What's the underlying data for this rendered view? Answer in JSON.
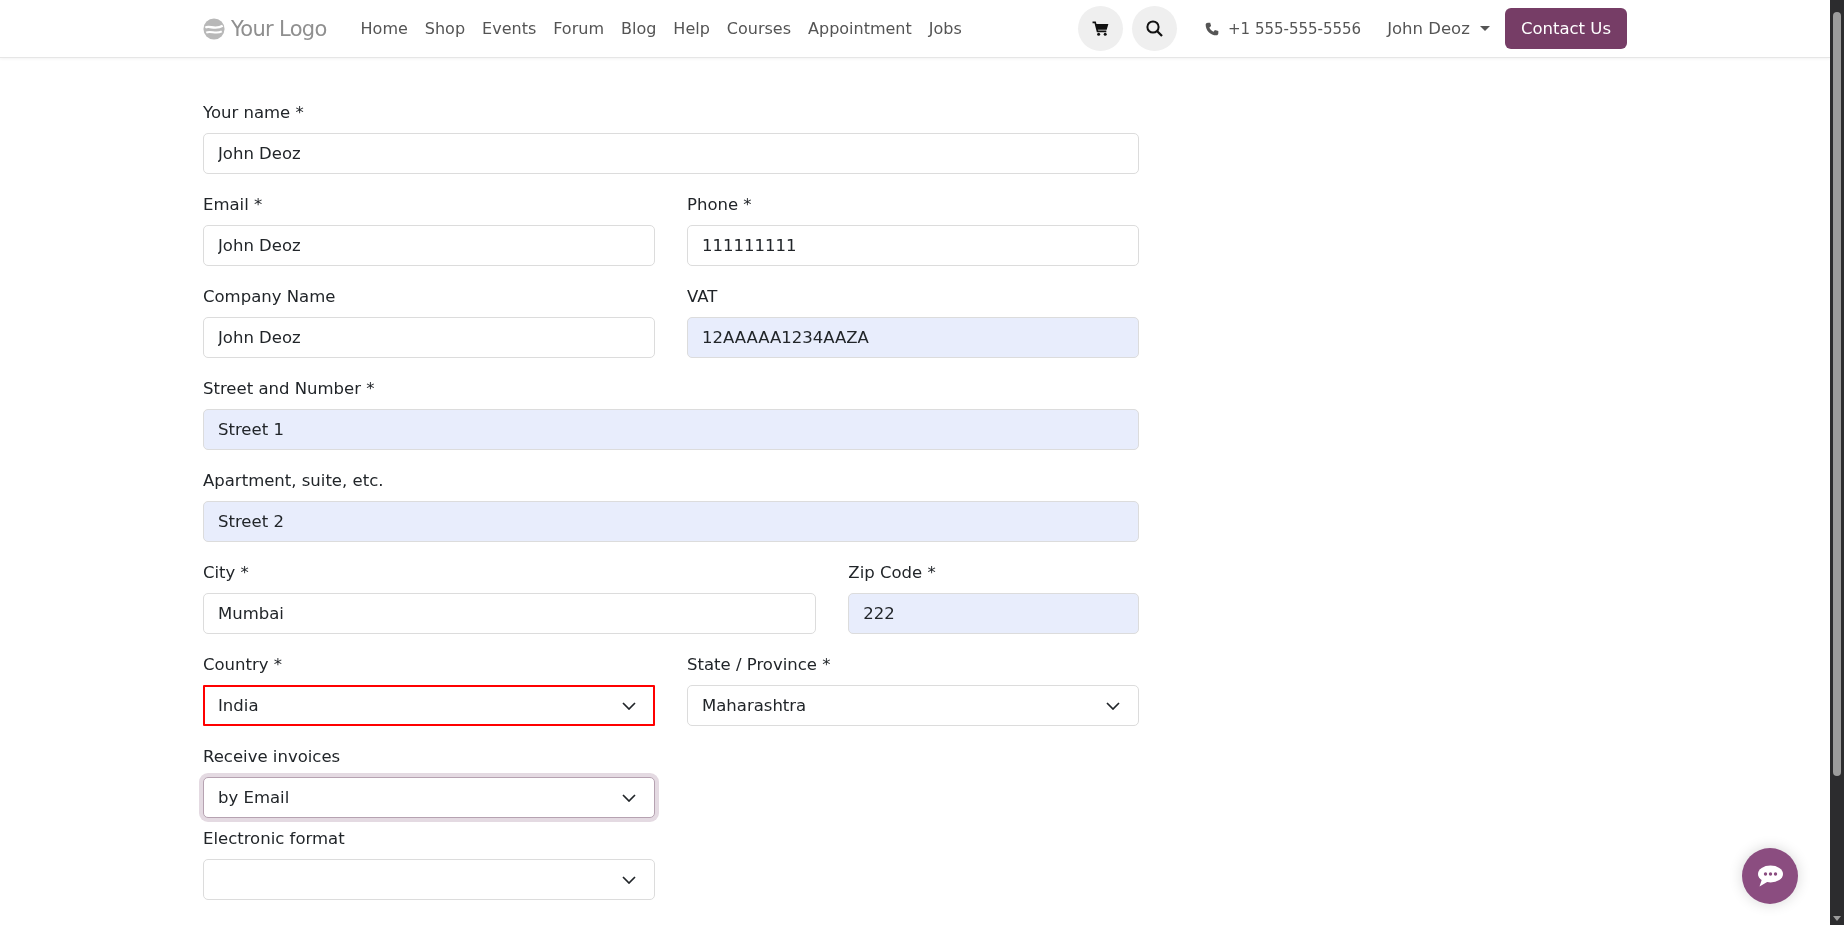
{
  "header": {
    "logo_text": "Your Logo",
    "nav": [
      "Home",
      "Shop",
      "Events",
      "Forum",
      "Blog",
      "Help",
      "Courses",
      "Appointment",
      "Jobs"
    ],
    "phone": "+1 555-555-5556",
    "user": "John Deoz",
    "contact_button": "Contact Us"
  },
  "form": {
    "fields": [
      {
        "label": "Your name *",
        "kind": "input",
        "value": "John Deoz",
        "autofilled": false,
        "invalid": false,
        "focused": false
      },
      {
        "label": "Email *",
        "kind": "input",
        "value": "John Deoz",
        "autofilled": false,
        "invalid": false,
        "focused": false
      },
      {
        "label": "Phone *",
        "kind": "input",
        "value": "111111111",
        "autofilled": false,
        "invalid": false,
        "focused": false
      },
      {
        "label": "Company Name",
        "kind": "input",
        "value": "John Deoz",
        "autofilled": false,
        "invalid": false,
        "focused": false
      },
      {
        "label": "VAT",
        "kind": "input",
        "value": "12AAAAA1234AAZA",
        "autofilled": true,
        "invalid": false,
        "focused": false
      },
      {
        "label": "Street and Number *",
        "kind": "input",
        "value": "Street 1",
        "autofilled": true,
        "invalid": false,
        "focused": false
      },
      {
        "label": "Apartment, suite, etc.",
        "kind": "input",
        "value": "Street 2",
        "autofilled": true,
        "invalid": false,
        "focused": false
      },
      {
        "label": "City *",
        "kind": "input",
        "value": "Mumbai",
        "autofilled": false,
        "invalid": false,
        "focused": false
      },
      {
        "label": "Zip Code *",
        "kind": "input",
        "value": "222",
        "autofilled": true,
        "invalid": false,
        "focused": false
      },
      {
        "label": "Country *",
        "kind": "select",
        "value": "India",
        "autofilled": false,
        "invalid": true,
        "focused": false
      },
      {
        "label": "State / Province *",
        "kind": "select",
        "value": "Maharashtra",
        "autofilled": false,
        "invalid": false,
        "focused": false
      },
      {
        "label": "Receive invoices",
        "kind": "select",
        "value": "by Email",
        "autofilled": false,
        "invalid": false,
        "focused": true
      },
      {
        "label": "Electronic format",
        "kind": "select",
        "autofilled": false,
        "invalid": false,
        "focused": false
      }
    ]
  }
}
